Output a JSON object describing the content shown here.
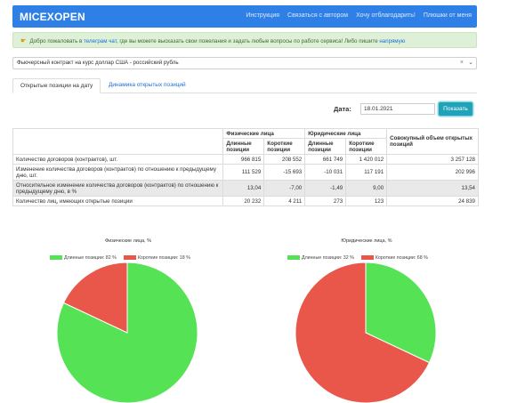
{
  "navbar": {
    "brand": "MICEXOPEN",
    "links": [
      "Инструкция",
      "Связаться с автором",
      "Хочу отблагодарить!",
      "Плюшки от меня"
    ]
  },
  "alert": {
    "prefix": "Добро пожаловать в ",
    "link1": "телеграм чат",
    "middle": ", где вы можете высказать свои пожелания и задать любые вопросы по работе сервиса! Либо пишите ",
    "link2": "напрямую"
  },
  "contract_select": {
    "value": "Фьючерсный контракт на курс доллар США - российский рубль",
    "clear": "×",
    "chevron": "⌄"
  },
  "tabs": [
    "Открытые позиции на дату",
    "Динамика открытых позиций"
  ],
  "date_form": {
    "label": "Дата:",
    "value": "18.01.2021",
    "button": "Показать"
  },
  "table": {
    "group_physical": "Физические лица",
    "group_legal": "Юридические лица",
    "sub_long": "Длинные позиции",
    "sub_short": "Короткие позиции",
    "total_header": "Совокупный объем открытых позиций",
    "rows": [
      {
        "label": "Количество договоров (контрактов), шт.",
        "values": [
          "966 815",
          "208 552",
          "661 749",
          "1 420 012",
          "3 257 128"
        ]
      },
      {
        "label": "Изменение количества договоров (контрактов) по отношению к предыдущему дню, шт.",
        "values": [
          "111 529",
          "-15 693",
          "-10 031",
          "117 191",
          "202 996"
        ]
      },
      {
        "label": "Относительное изменение количества договоров (контрактов) по отношению к предыдущему дню, в %",
        "values": [
          "13,04",
          "-7,00",
          "-1,49",
          "9,00",
          "13,54"
        ]
      },
      {
        "label": "Количество лиц, имеющих открытые позиции",
        "values": [
          "20 232",
          "4 211",
          "273",
          "123",
          "24 839"
        ]
      }
    ]
  },
  "chart_data": [
    {
      "type": "pie",
      "title": "Физические лица, %",
      "labels": [
        "Длинные позиции: 82 %",
        "Короткие позиции: 18 %"
      ],
      "values": [
        82,
        18
      ],
      "colors": [
        "#55e355",
        "#e8574a"
      ],
      "legend": "top"
    },
    {
      "type": "pie",
      "title": "Юридические лица, %",
      "labels": [
        "Длинные позиции: 32 %",
        "Короткие позиции: 68 %"
      ],
      "values": [
        32,
        68
      ],
      "colors": [
        "#55e355",
        "#e8574a"
      ],
      "legend": "top"
    }
  ]
}
